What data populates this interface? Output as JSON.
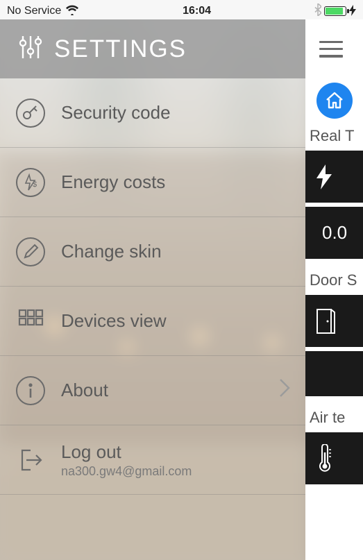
{
  "status": {
    "carrier": "No Service",
    "time": "16:04"
  },
  "sidebar": {
    "title": "SETTINGS",
    "items": [
      {
        "label": "Security code"
      },
      {
        "label": "Energy costs"
      },
      {
        "label": "Change skin"
      },
      {
        "label": "Devices view"
      },
      {
        "label": "About"
      },
      {
        "label": "Log out",
        "sub": "na300.gw4@gmail.com"
      }
    ]
  },
  "main": {
    "section1_label": "Real T",
    "tile1_value": "0.0",
    "section2_label": "Door S",
    "section3_label": "Air te"
  }
}
